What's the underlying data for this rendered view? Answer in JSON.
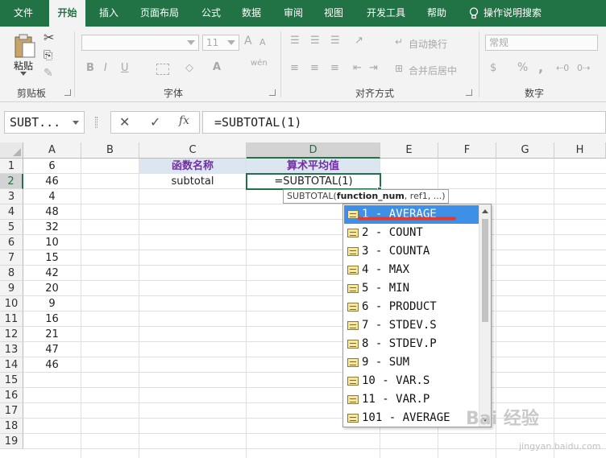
{
  "ribbon_tabs": [
    "文件",
    "开始",
    "插入",
    "页面布局",
    "公式",
    "数据",
    "审阅",
    "视图",
    "开发工具",
    "帮助"
  ],
  "active_tab": "开始",
  "tell_me": "操作说明搜索",
  "ribbon": {
    "clipboard": {
      "paste_label": "粘贴",
      "group_label": "剪贴板"
    },
    "font": {
      "font_name": "",
      "font_size": "11",
      "bold": "B",
      "italic": "I",
      "underline": "U",
      "group_label": "字体",
      "grow": "A",
      "shrink": "A",
      "phonetic": "wén"
    },
    "alignment": {
      "wrap_text": "自动换行",
      "merge_center": "合并后居中",
      "group_label": "对齐方式"
    },
    "number": {
      "format": "常规",
      "percent": "%",
      "comma": ",",
      "group_label": "数字"
    }
  },
  "formula_bar": {
    "name_box": "SUBT...",
    "cancel": "✕",
    "enter": "✓",
    "fx": "fx",
    "formula": "=SUBTOTAL(1)"
  },
  "columns": [
    "A",
    "B",
    "C",
    "D",
    "E",
    "F",
    "G",
    "H"
  ],
  "selected_column": "D",
  "rows": [
    "1",
    "2",
    "3",
    "4",
    "5",
    "6",
    "7",
    "8",
    "9",
    "10",
    "11",
    "12",
    "13",
    "14",
    "15",
    "16",
    "17",
    "18",
    "19"
  ],
  "selected_row": "2",
  "column_a_values": [
    "6",
    "46",
    "4",
    "48",
    "32",
    "10",
    "15",
    "42",
    "20",
    "9",
    "16",
    "21",
    "47",
    "46"
  ],
  "cells": {
    "c1": "函数名称",
    "d1": "算术平均值",
    "c2": "subtotal",
    "d2": "=SUBTOTAL(1)"
  },
  "tooltip": {
    "fn": "SUBTOTAL(",
    "arg": "function_num",
    "rest": ", ref1, ...)"
  },
  "autocomplete": [
    "1 - AVERAGE",
    "2 - COUNT",
    "3 - COUNTA",
    "4 - MAX",
    "5 - MIN",
    "6 - PRODUCT",
    "7 - STDEV.S",
    "8 - STDEV.P",
    "9 - SUM",
    "10 - VAR.S",
    "11 - VAR.P",
    "101 - AVERAGE"
  ],
  "selected_autocomplete": "1 - AVERAGE",
  "watermark": {
    "main": "Bai 经验",
    "sub": "jingyan.baidu.com"
  },
  "colors": {
    "accent": "#217346",
    "header_fill": "#dce6f1",
    "header_text": "#7030a0",
    "selection": "#3e8fe6",
    "annotation": "#e23b2e"
  }
}
